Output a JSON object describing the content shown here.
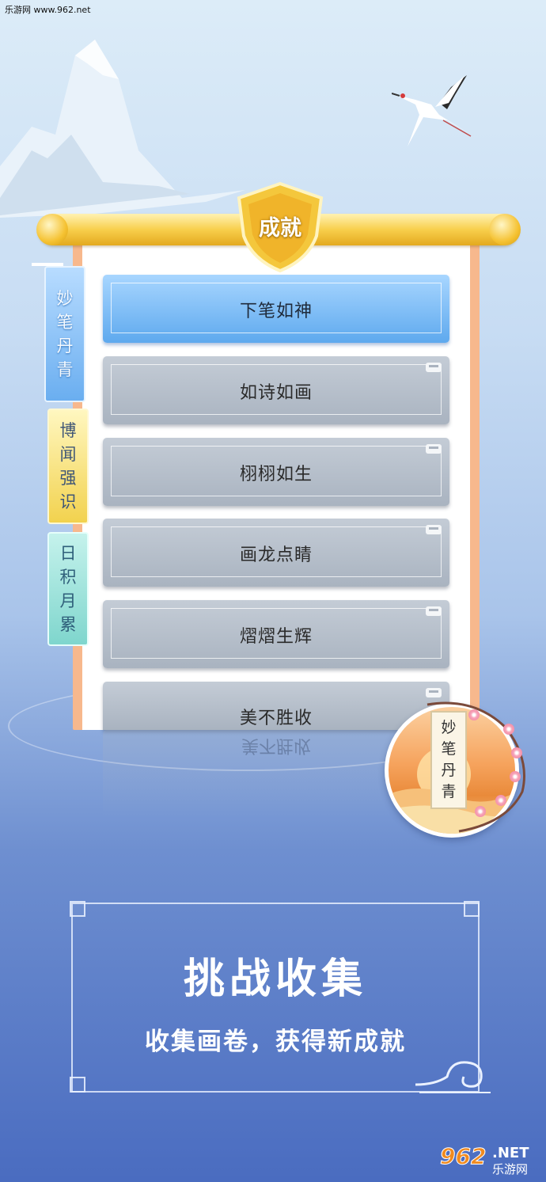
{
  "watermark": "乐游网 www.962.net",
  "header": {
    "title": "成就"
  },
  "tabs": [
    {
      "chars": [
        "妙",
        "笔",
        "丹",
        "青"
      ]
    },
    {
      "chars": [
        "博",
        "闻",
        "强",
        "识"
      ]
    },
    {
      "chars": [
        "日",
        "积",
        "月",
        "累"
      ]
    }
  ],
  "achievements": [
    {
      "label": "下笔如神",
      "state": "unlocked"
    },
    {
      "label": "如诗如画",
      "state": "locked"
    },
    {
      "label": "栩栩如生",
      "state": "locked"
    },
    {
      "label": "画龙点睛",
      "state": "locked"
    },
    {
      "label": "熠熠生辉",
      "state": "locked"
    },
    {
      "label": "美不胜收",
      "state": "locked"
    }
  ],
  "reflection_text": "美不胜收",
  "medallion": {
    "chars": [
      "妙",
      "笔",
      "丹",
      "青"
    ]
  },
  "banner": {
    "title": "挑战收集",
    "subtitle": "收集画卷，获得新成就"
  },
  "logo": {
    "number": "962",
    "net": ".NET",
    "cn": "乐游网"
  },
  "colors": {
    "active_item": "#5ea9ee",
    "locked_item": "#a9b3c0",
    "rod": "#f8cf4c",
    "panel_border": "#f7b88d"
  }
}
